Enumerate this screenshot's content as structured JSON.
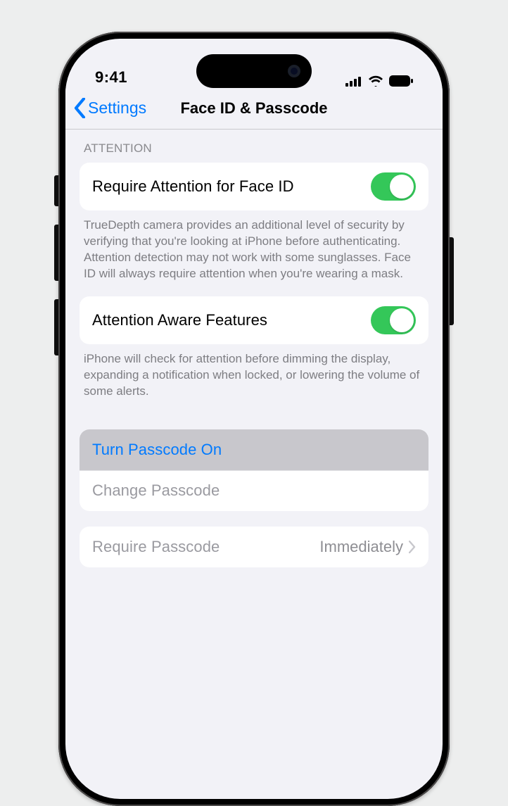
{
  "status": {
    "time": "9:41"
  },
  "nav": {
    "back_label": "Settings",
    "title": "Face ID & Passcode"
  },
  "attention": {
    "section_header": "Attention",
    "require_label": "Require Attention for Face ID",
    "require_on": true,
    "require_note": "TrueDepth camera provides an additional level of security by verifying that you're looking at iPhone before authenticating. Attention detection may not work with some sunglasses. Face ID will always require attention when you're wearing a mask.",
    "aware_label": "Attention Aware Features",
    "aware_on": true,
    "aware_note": "iPhone will check for attention before dimming the display, expanding a notification when locked, or lowering the volume of some alerts."
  },
  "passcode": {
    "turn_on_label": "Turn Passcode On",
    "change_label": "Change Passcode",
    "require_label": "Require Passcode",
    "require_value": "Immediately"
  }
}
